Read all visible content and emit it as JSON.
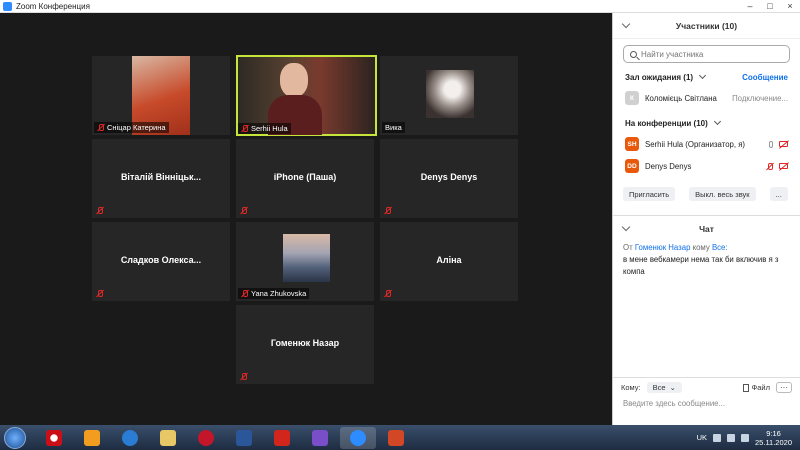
{
  "window": {
    "title": "Zoom Конференция",
    "controls": [
      "–",
      "□",
      "×"
    ]
  },
  "tiles": [
    {
      "name": "Сніцар Катерина",
      "kind": "video",
      "muted": true
    },
    {
      "name": "Serhii Hula",
      "kind": "video",
      "muted": true,
      "active_speaker": true
    },
    {
      "name": "Вика",
      "kind": "video",
      "muted": false
    },
    {
      "name": "Віталій Вінніцьк...",
      "kind": "name",
      "muted": true
    },
    {
      "name": "iPhone (Паша)",
      "kind": "name",
      "muted": true
    },
    {
      "name": "Denys Denys",
      "kind": "name",
      "muted": true
    },
    {
      "name": "Сладков  Олекса...",
      "kind": "name",
      "muted": true
    },
    {
      "name": "Yana Zhukovska",
      "kind": "video",
      "muted": true
    },
    {
      "name": "Аліна",
      "kind": "name",
      "muted": true
    },
    {
      "name": "Гоменюк Назар",
      "kind": "name",
      "muted": true
    }
  ],
  "participants_panel": {
    "title": "Участники (10)",
    "search_placeholder": "Найти участника",
    "waiting_room": {
      "label": "Зал ожидания (1)",
      "admit_label": "Сообщение",
      "people": [
        {
          "initial": "К",
          "name": "Коломієць Світлана",
          "status": "Подключение..."
        }
      ]
    },
    "in_meeting": {
      "label": "На конференции (10)",
      "people": [
        {
          "initials": "SH",
          "name": "Serhii Hula (Организатор, я)",
          "color": "#e8590c"
        },
        {
          "initials": "DD",
          "name": "Denys Denys",
          "color": "#e8590c"
        }
      ]
    },
    "buttons": {
      "invite": "Пригласить",
      "mute_all": "Выкл. весь звук",
      "more": "..."
    }
  },
  "chat": {
    "title": "Чат",
    "message": {
      "prefix": "От",
      "sender": "Гоменюк Назар",
      "to_word": "кому",
      "recipient": "Все:",
      "text": "в мене вебкамери нема так би включив я з компа"
    },
    "to_label": "Кому:",
    "to_value": "Все",
    "file_label": "Файл",
    "more_label": "···",
    "input_placeholder": "Введите здесь сообщение..."
  },
  "taskbar": {
    "apps": [
      "opera",
      "media-player",
      "ie",
      "explorer",
      "cyberlink",
      "word",
      "pdf",
      "visual-studio",
      "zoom",
      "powerpoint"
    ],
    "active_app": "zoom",
    "lang": "UK",
    "time": "9:16",
    "date": "25.11.2020"
  },
  "colors": {
    "accent": "#0e71eb",
    "muted_red": "#e02828",
    "active_border": "#c6e53b"
  }
}
